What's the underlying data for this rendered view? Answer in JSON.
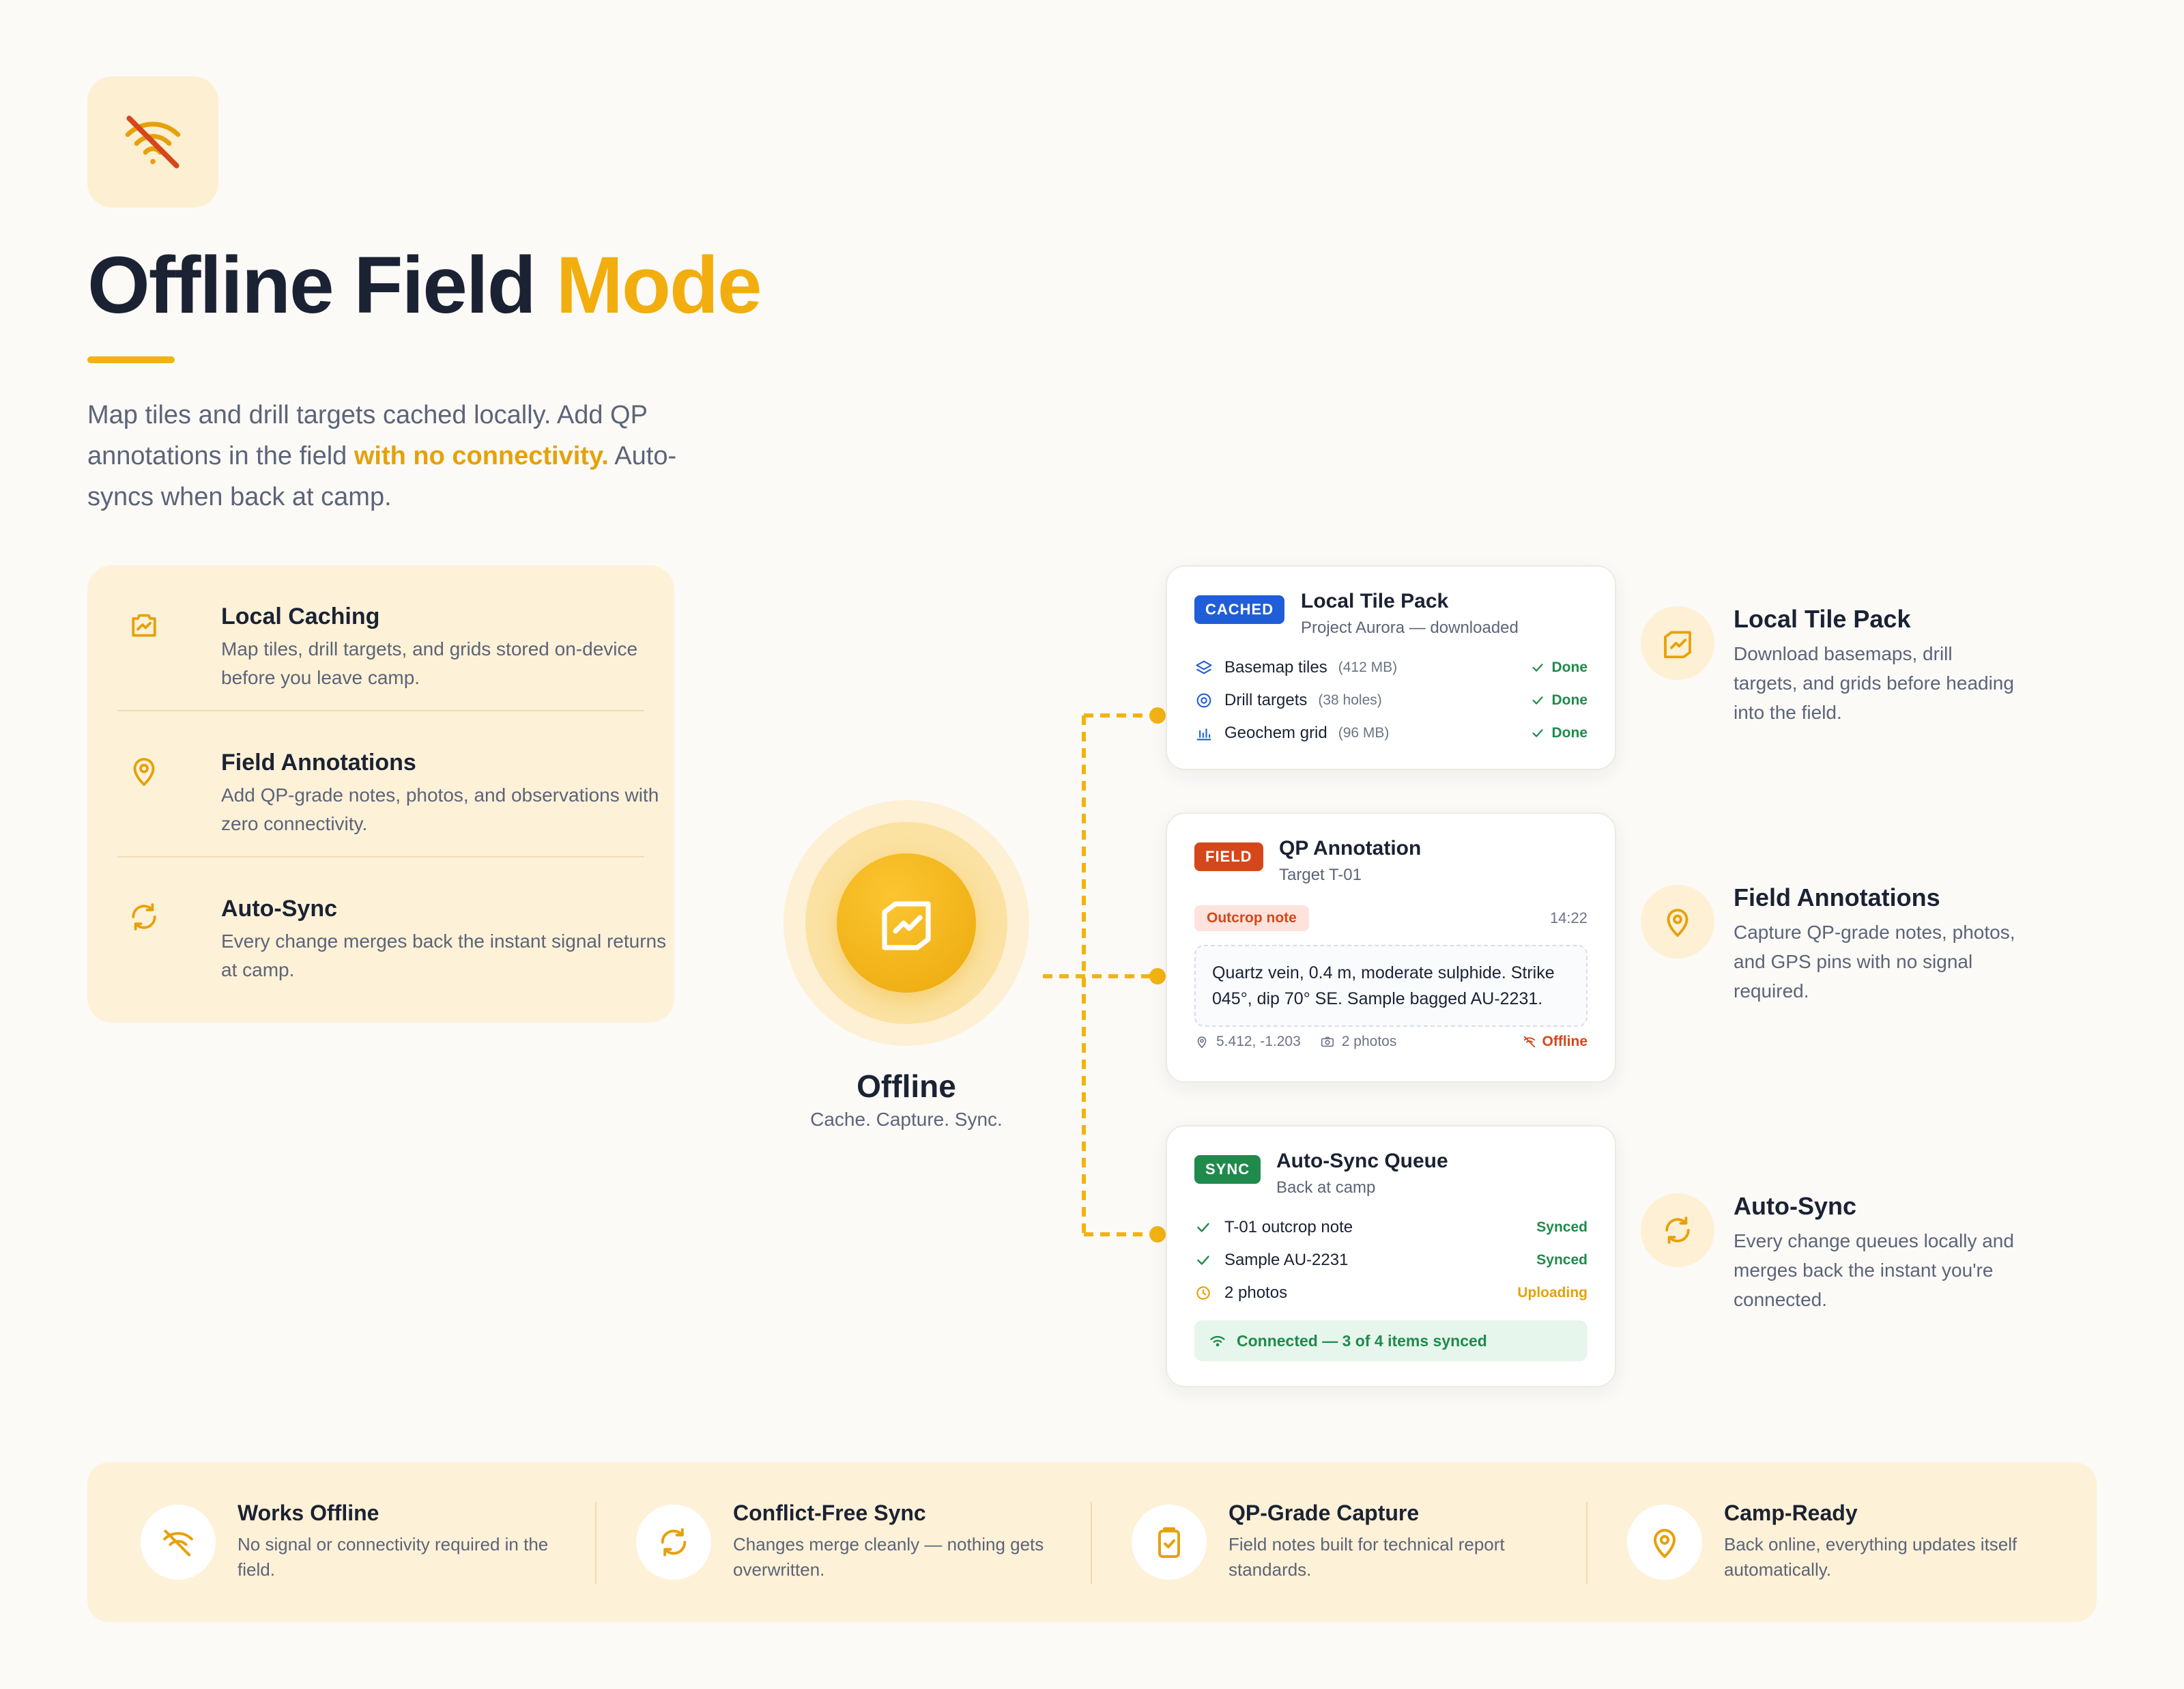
{
  "header": {
    "title_main": "Offline Field",
    "title_accent": "Mode",
    "intro_part1": "Map tiles and drill targets cached locally. Add QP annotations in the field ",
    "intro_highlight": "with no connectivity.",
    "intro_part2": " Auto-syncs when back at camp."
  },
  "features": [
    {
      "title": "Local Caching",
      "desc": "Map tiles, drill targets, and grids stored on-device before you leave camp.",
      "icon": "map-chart-icon"
    },
    {
      "title": "Field Annotations",
      "desc": "Add QP-grade notes, photos, and observations with zero connectivity.",
      "icon": "map-pin-icon"
    },
    {
      "title": "Auto-Sync",
      "desc": "Every change merges back the instant signal returns at camp.",
      "icon": "sync-icon"
    }
  ],
  "hub": {
    "title": "Offline",
    "subtitle": "Cache. Capture. Sync."
  },
  "cards": {
    "tile_pack": {
      "badge": "CACHED",
      "title": "Local Tile Pack",
      "subtitle": "Project Aurora — downloaded",
      "rows": [
        {
          "label": "Basemap tiles",
          "size": "(412 MB)",
          "status": "Done"
        },
        {
          "label": "Drill targets",
          "size": "(38 holes)",
          "status": "Done"
        },
        {
          "label": "Geochem grid",
          "size": "(96 MB)",
          "status": "Done"
        }
      ]
    },
    "annotation": {
      "badge": "FIELD",
      "title": "QP Annotation",
      "subtitle": "Target T-01",
      "tag": "Outcrop note",
      "time": "14:22",
      "note": "Quartz vein, 0.4 m, moderate sulphide. Strike 045°, dip 70° SE. Sample bagged AU-2231.",
      "coords": "5.412, -1.203",
      "photos": "2 photos",
      "status": "Offline"
    },
    "sync": {
      "badge": "SYNC",
      "title": "Auto-Sync Queue",
      "subtitle": "Back at camp",
      "rows": [
        {
          "label": "T-01 outcrop note",
          "status": "Synced"
        },
        {
          "label": "Sample AU-2231",
          "status": "Synced"
        },
        {
          "label": "2 photos",
          "status": "Uploading"
        }
      ],
      "connection": "Connected — 3 of 4 items synced"
    }
  },
  "side_notes": [
    {
      "title": "Local Tile Pack",
      "desc": "Download basemaps, drill targets, and grids before heading into the field."
    },
    {
      "title": "Field Annotations",
      "desc": "Capture QP-grade notes, photos, and GPS pins with no signal required."
    },
    {
      "title": "Auto-Sync",
      "desc": "Every change queues locally and merges back the instant you're connected."
    }
  ],
  "bottom": [
    {
      "title": "Works Offline",
      "desc": "No signal or connectivity required in the field.",
      "icon": "no-signal-icon"
    },
    {
      "title": "Conflict-Free Sync",
      "desc": "Changes merge cleanly — nothing gets overwritten.",
      "icon": "sync-icon"
    },
    {
      "title": "QP-Grade Capture",
      "desc": "Field notes built for technical report standards.",
      "icon": "clipboard-icon"
    },
    {
      "title": "Camp-Ready",
      "desc": "Back online, everything updates itself automatically.",
      "icon": "map-pin-icon"
    }
  ],
  "colors": {
    "accent": "#f2ae0e",
    "navy": "#1b2233",
    "cached_badge": "#1f5ed6",
    "field_badge": "#d5471b",
    "sync_badge": "#1f8a4c",
    "panel": "#fdf1d8"
  }
}
